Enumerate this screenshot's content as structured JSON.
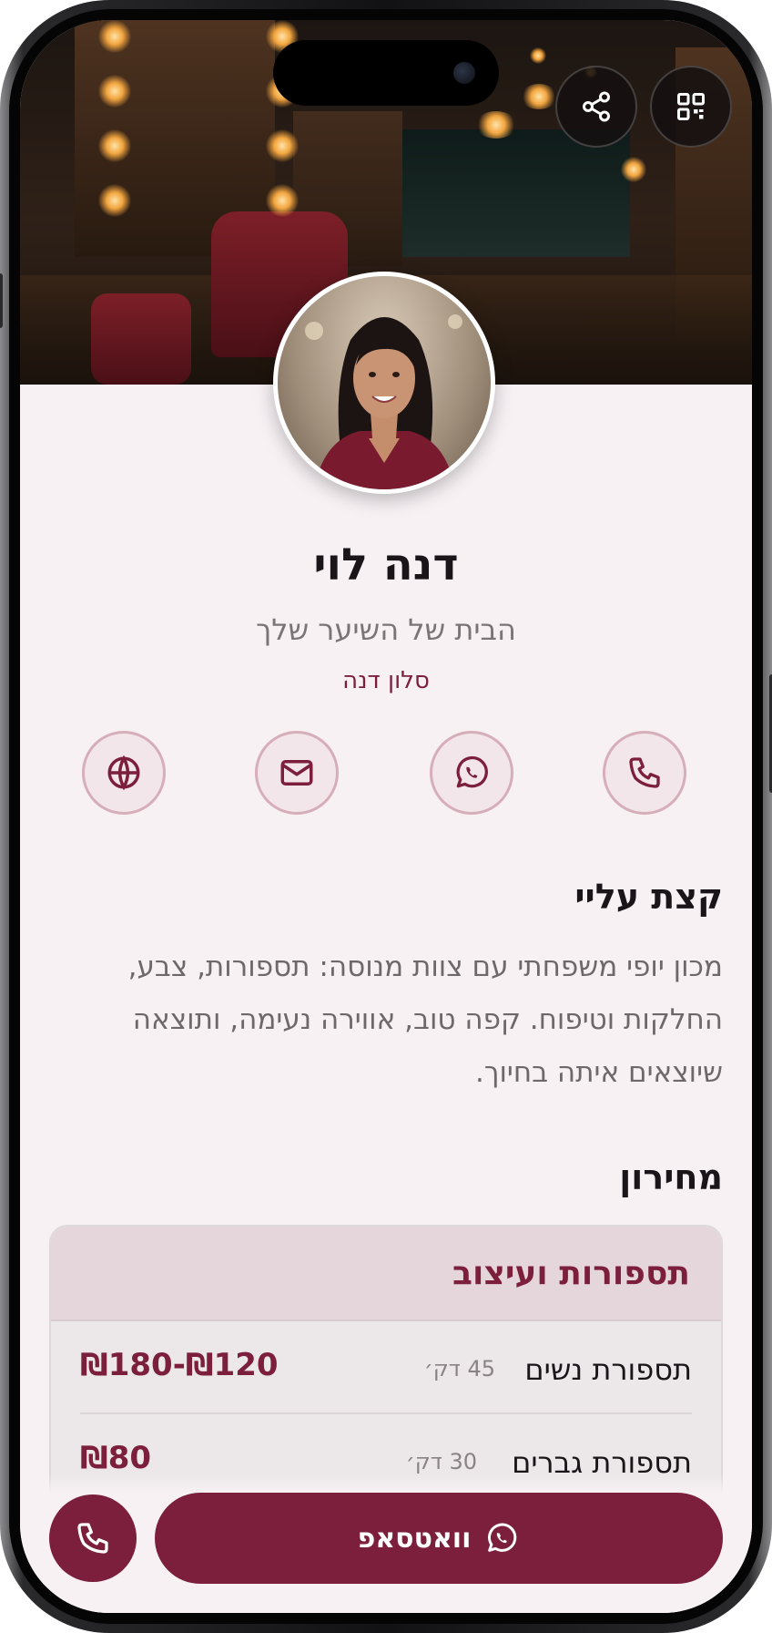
{
  "top_actions": {
    "share_icon": "share-icon",
    "qr_icon": "qr-code-icon"
  },
  "profile": {
    "name": "דנה לוי",
    "tagline": "הבית של השיער שלך",
    "business": "סלון דנה"
  },
  "contacts": [
    {
      "icon": "globe-icon"
    },
    {
      "icon": "mail-icon"
    },
    {
      "icon": "whatsapp-icon"
    },
    {
      "icon": "phone-icon"
    }
  ],
  "about": {
    "title": "קצת עליי",
    "lines": [
      "מכון יופי משפחתי עם צוות מנוסה: תספורות, צבע,",
      "החלקות וטיפוח. קפה טוב, אווירה נעימה, ותוצאה",
      "שיוצאים איתה בחיוך."
    ]
  },
  "pricing": {
    "title": "מחירון",
    "category": "תספורות ועיצוב",
    "items": [
      {
        "service": "תספורת נשים",
        "duration": "45 דק׳",
        "price": "₪120-₪180"
      },
      {
        "service": "תספורת גברים",
        "duration": "30 דק׳",
        "price": "₪80"
      }
    ]
  },
  "cta": {
    "whatsapp_label": "וואטסאפ"
  },
  "colors": {
    "brand": "#7b1f3d",
    "background": "#f7f1f4",
    "text": "#1a1519",
    "muted": "#7a7476"
  }
}
